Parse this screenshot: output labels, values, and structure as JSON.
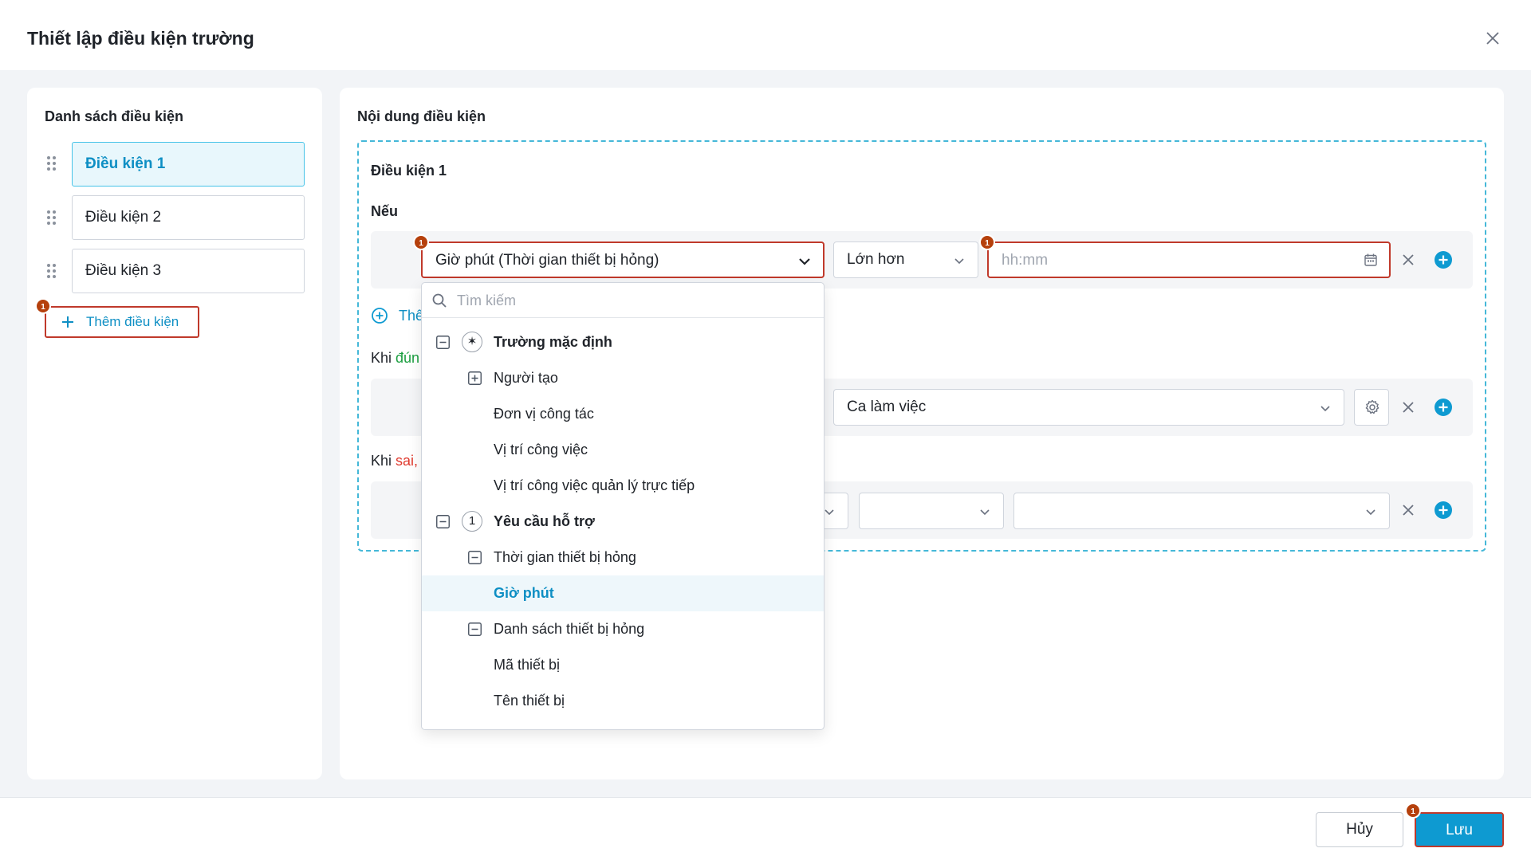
{
  "dialog": {
    "title": "Thiết lập điều kiện trường"
  },
  "left": {
    "title": "Danh sách điều kiện",
    "items": [
      "Điều kiện 1",
      "Điều kiện 2",
      "Điều kiện 3"
    ],
    "add_label": "Thêm điều kiện",
    "add_badge": "1"
  },
  "right": {
    "title": "Nội dung điều kiện",
    "condition_title": "Điều kiện 1",
    "if_label": "Nếu",
    "field_select": {
      "value": "Giờ phút (Thời gian thiết bị hỏng)",
      "badge": "1"
    },
    "operator_select": {
      "value": "Lớn hơn"
    },
    "time_input": {
      "placeholder": "hh:mm",
      "badge": "1"
    },
    "add_more_label": "Thê",
    "when_true": {
      "prefix": "Khi ",
      "keyword": "đún"
    },
    "when_true_select": {
      "value": "Ca làm việc"
    },
    "when_false": {
      "prefix": "Khi ",
      "keyword": "sai,"
    }
  },
  "dropdown": {
    "search_placeholder": "Tìm kiếm",
    "rows": [
      {
        "label": "Trường mặc định",
        "level": 0,
        "toggle": "minus",
        "circle": "✶",
        "bold": true
      },
      {
        "label": "Người tạo",
        "level": 1,
        "toggle": "plus"
      },
      {
        "label": "Đơn vị công tác",
        "level": 1
      },
      {
        "label": "Vị trí công việc",
        "level": 1
      },
      {
        "label": "Vị trí công việc quản lý trực tiếp",
        "level": 1
      },
      {
        "label": "Yêu cầu hỗ trợ",
        "level": 0,
        "toggle": "minus",
        "circle": "1",
        "bold": true
      },
      {
        "label": "Thời gian thiết bị hỏng",
        "level": 1,
        "toggle": "minus"
      },
      {
        "label": "Giờ phút",
        "level": 1,
        "selected": true
      },
      {
        "label": "Danh sách thiết bị hỏng",
        "level": 1,
        "toggle": "minus"
      },
      {
        "label": "Mã thiết bị",
        "level": 1
      },
      {
        "label": "Tên thiết bị",
        "level": 1
      }
    ]
  },
  "footer": {
    "cancel_label": "Hủy",
    "save_label": "Lưu",
    "save_badge": "1"
  },
  "colors": {
    "accent": "#0e9ad1",
    "error_border": "#c0392b",
    "badge": "#b5400c",
    "true_text": "#1a9e3f",
    "false_text": "#e03b2f"
  },
  "icons": [
    "close-icon",
    "drag-handle-icon",
    "plus-icon",
    "chevron-down-icon",
    "calendar-icon",
    "remove-icon",
    "add-circle-icon",
    "gear-icon",
    "search-icon",
    "collapse-icon",
    "expand-icon"
  ]
}
